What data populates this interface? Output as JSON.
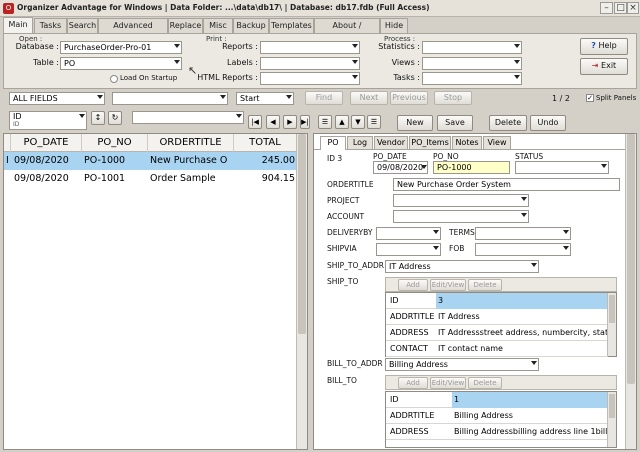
{
  "window": {
    "title": "Organizer Advantage for Windows | Data Folder: ...\\data\\db17\\ | Database: db17.fdb (Full Access)"
  },
  "main_tabs": [
    "Main",
    "Tasks",
    "Search",
    "Advanced Search",
    "Replace",
    "Misc",
    "Backup",
    "Templates",
    "About / Upgrade",
    "Hide"
  ],
  "open_group": {
    "label": "Open :",
    "database_label": "Database :",
    "database_value": "PurchaseOrder-Pro-01",
    "table_label": "Table :",
    "table_value": "PO",
    "load_on_startup": "Load On Startup"
  },
  "print_group": {
    "label": "Print :",
    "reports": "Reports :",
    "labels": "Labels :",
    "html_reports": "HTML Reports :"
  },
  "process_group": {
    "label": "Process :",
    "statistics": "Statistics :",
    "views": "Views :",
    "tasks": "Tasks :"
  },
  "help_button": "Help",
  "exit_button": "Exit",
  "search_bar": {
    "field": "ALL FIELDS",
    "mode": "Start",
    "find": "Find",
    "next": "Next",
    "previous": "Previous",
    "stop": "Stop",
    "counter": "1 / 2",
    "split_panels": "Split Panels"
  },
  "sort_bar": {
    "field": "ID",
    "sub": "ID"
  },
  "grid": {
    "columns": [
      "PO_DATE",
      "PO_NO",
      "ORDERTITLE",
      "TOTAL"
    ],
    "rows": [
      {
        "indicator": "I",
        "po_date": "09/08/2020",
        "po_no": "PO-1000",
        "ordertitle": "New Purchase O",
        "total": "245.00"
      },
      {
        "indicator": "",
        "po_date": "09/08/2020",
        "po_no": "PO-1001",
        "ordertitle": "Order Sample",
        "total": "904.15"
      }
    ]
  },
  "record_toolbar": {
    "new": "New",
    "save": "Save",
    "delete": "Delete",
    "undo": "Undo"
  },
  "record_tabs": [
    "PO",
    "Log",
    "Vendor",
    "PO_Items",
    "Notes",
    "View"
  ],
  "record": {
    "id_label": "ID 3",
    "po_date_label": "PO_DATE",
    "po_date": "09/08/2020",
    "po_no_label": "PO_NO",
    "po_no": "PO-1000",
    "status_label": "STATUS",
    "ordertitle_label": "ORDERTITLE",
    "ordertitle": "New Purchase Order System",
    "project_label": "PROJECT",
    "account_label": "ACCOUNT",
    "deliveryby_label": "DELIVERYBY",
    "terms_label": "TERMS",
    "shipvia_label": "SHIPVIA",
    "fob_label": "FOB",
    "ship_to_addr_label": "SHIP_TO_ADDR",
    "ship_to_addr": "IT Address",
    "ship_to_label": "SHIP_TO",
    "bill_to_addr_label": "BILL_TO_ADDR",
    "bill_to_addr": "Billing Address",
    "bill_to_label": "BILL_TO"
  },
  "subgrid_toolbar": {
    "add": "Add",
    "edit_view": "Edit/View",
    "delete": "Delete"
  },
  "ship_to": [
    {
      "k": "ID",
      "v": "3"
    },
    {
      "k": "ADDRTITLE",
      "v": "IT Address"
    },
    {
      "k": "ADDRESS",
      "v": "IT Addressstreet address, numbercity, state  zi"
    },
    {
      "k": "CONTACT",
      "v": "IT contact name"
    }
  ],
  "bill_to": [
    {
      "k": "ID",
      "v": "1"
    },
    {
      "k": "ADDRTITLE",
      "v": "Billing Address"
    },
    {
      "k": "ADDRESS",
      "v": "Billing Addressbilling address line 1billing a"
    }
  ],
  "colors": {
    "selection": "#a8d4f2",
    "po_no_highlight": "#ffffc8"
  }
}
